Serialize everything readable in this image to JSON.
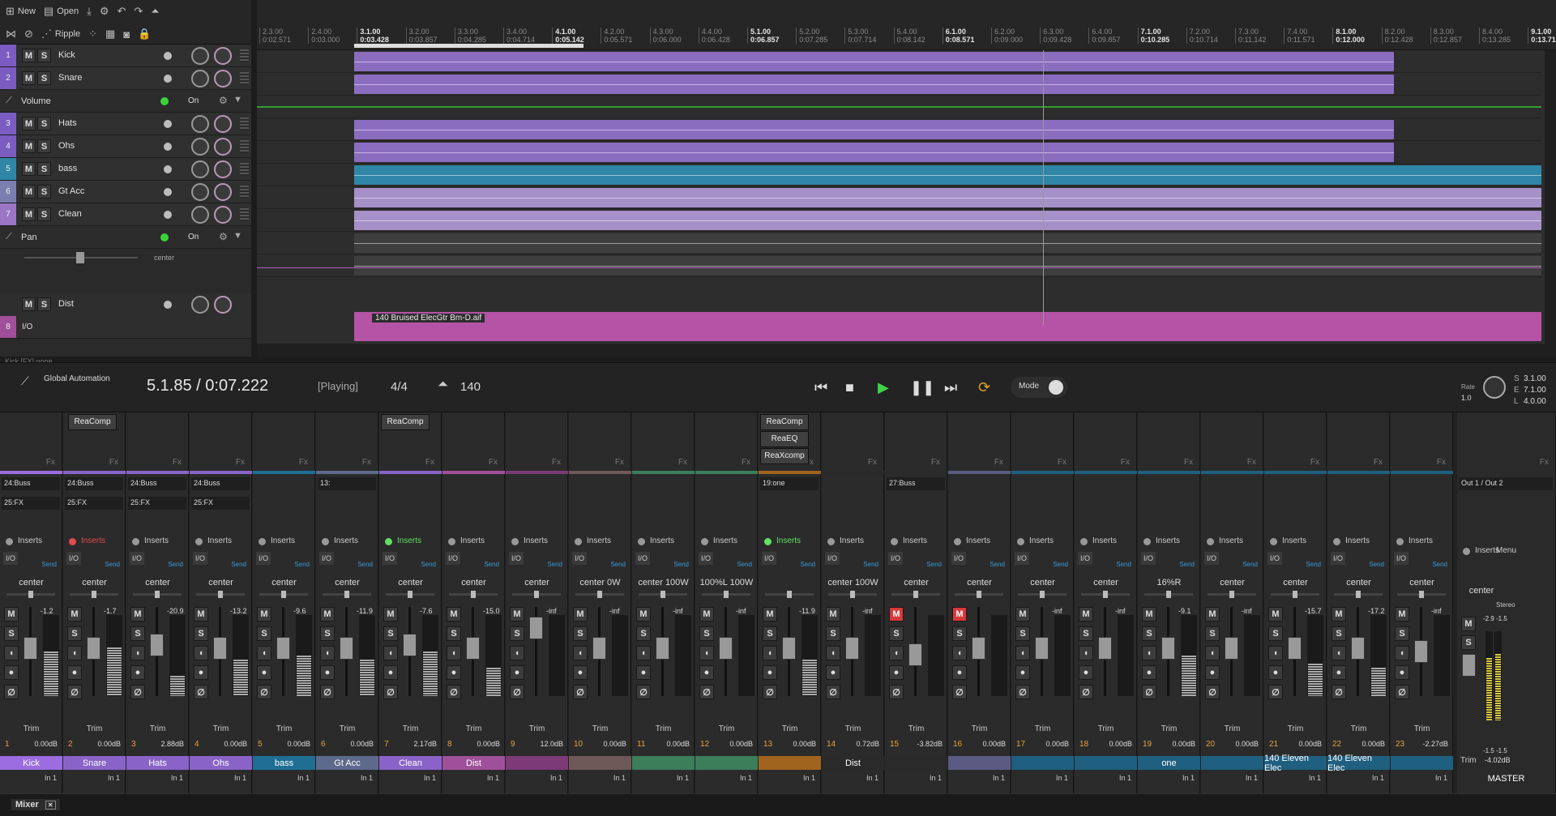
{
  "toolbar": {
    "row1": [
      {
        "icon": "new-icon",
        "glyph": "⊞",
        "label": "New"
      },
      {
        "icon": "open-icon",
        "glyph": "▤",
        "label": "Open"
      },
      {
        "icon": "save-icon",
        "glyph": "⤓",
        "label": ""
      },
      {
        "icon": "settings-icon",
        "glyph": "⚙",
        "label": ""
      },
      {
        "icon": "undo-icon",
        "glyph": "↶",
        "label": ""
      },
      {
        "icon": "redo-icon",
        "glyph": "↷",
        "label": ""
      },
      {
        "icon": "metronome-icon",
        "glyph": "⏶",
        "label": ""
      }
    ],
    "row2": [
      {
        "icon": "trim-icon",
        "glyph": "⋈",
        "label": ""
      },
      {
        "icon": "link-icon",
        "glyph": "⊘",
        "label": ""
      },
      {
        "icon": "ripple-icon",
        "glyph": "⋰",
        "label": "Ripple"
      },
      {
        "icon": "grid-icon",
        "glyph": "⁘",
        "label": ""
      },
      {
        "icon": "snap-icon",
        "glyph": "▦",
        "label": ""
      },
      {
        "icon": "envelope-icon",
        "glyph": "◙",
        "label": ""
      },
      {
        "icon": "lock-icon",
        "glyph": "🔒",
        "label": ""
      }
    ]
  },
  "tracks": [
    {
      "num": "1",
      "name": "Kick",
      "color": "#7b5cc0",
      "type": "track"
    },
    {
      "num": "2",
      "name": "Snare",
      "color": "#7b5cc0",
      "type": "track"
    },
    {
      "num": "",
      "name": "Volume",
      "color": "#2c2c2c",
      "type": "envelope",
      "on": "On"
    },
    {
      "num": "3",
      "name": "Hats",
      "color": "#7b5cc0",
      "type": "track"
    },
    {
      "num": "4",
      "name": "Ohs",
      "color": "#7b5cc0",
      "type": "track"
    },
    {
      "num": "5",
      "name": "bass",
      "color": "#2f86a6",
      "type": "track"
    },
    {
      "num": "6",
      "name": "Gt Acc",
      "color": "#7b7fb0",
      "type": "track"
    },
    {
      "num": "7",
      "name": "Clean",
      "color": "#9b76c4",
      "type": "track"
    },
    {
      "num": "",
      "name": "Pan",
      "color": "#2c2c2c",
      "type": "envelope",
      "on": "On"
    }
  ],
  "pan_envelope_value": "center",
  "folder_track": {
    "num": "8",
    "name": "Dist",
    "io": "I/O"
  },
  "track_status": "Kick [FX] none",
  "timeline": {
    "bars": [
      {
        "bar": "2.3.00",
        "time": "0:02.571",
        "major": false
      },
      {
        "bar": "2.4.00",
        "time": "0:03.000",
        "major": false
      },
      {
        "bar": "3.1.00",
        "time": "0:03.428",
        "major": true
      },
      {
        "bar": "3.2.00",
        "time": "0:03.857",
        "major": false
      },
      {
        "bar": "3.3.00",
        "time": "0:04.285",
        "major": false
      },
      {
        "bar": "3.4.00",
        "time": "0:04.714",
        "major": false
      },
      {
        "bar": "4.1.00",
        "time": "0:05.142",
        "major": true
      },
      {
        "bar": "4.2.00",
        "time": "0:05.571",
        "major": false
      },
      {
        "bar": "4.3.00",
        "time": "0:06.000",
        "major": false
      },
      {
        "bar": "4.4.00",
        "time": "0:06.428",
        "major": false
      },
      {
        "bar": "5.1.00",
        "time": "0:06.857",
        "major": true
      },
      {
        "bar": "5.2.00",
        "time": "0:07.285",
        "major": false
      },
      {
        "bar": "5.3.00",
        "time": "0:07.714",
        "major": false
      },
      {
        "bar": "5.4.00",
        "time": "0:08.142",
        "major": false
      },
      {
        "bar": "6.1.00",
        "time": "0:08.571",
        "major": true
      },
      {
        "bar": "6.2.00",
        "time": "0:09.000",
        "major": false
      },
      {
        "bar": "6.3.00",
        "time": "0:09.428",
        "major": false
      },
      {
        "bar": "6.4.00",
        "time": "0:09.857",
        "major": false
      },
      {
        "bar": "7.1.00",
        "time": "0:10.285",
        "major": true
      },
      {
        "bar": "7.2.00",
        "time": "0:10.714",
        "major": false
      },
      {
        "bar": "7.3.00",
        "time": "0:11.142",
        "major": false
      },
      {
        "bar": "7.4.00",
        "time": "0:11.571",
        "major": false
      },
      {
        "bar": "8.1.00",
        "time": "0:12.000",
        "major": true
      },
      {
        "bar": "8.2.00",
        "time": "0:12.428",
        "major": false
      },
      {
        "bar": "8.3.00",
        "time": "0:12.857",
        "major": false
      },
      {
        "bar": "8.4.00",
        "time": "0:13.285",
        "major": false
      },
      {
        "bar": "9.1.00",
        "time": "0:13.714",
        "major": true
      }
    ]
  },
  "item_label": "140 Bruised ElecGtr Bm-D.aif",
  "transport": {
    "global_automation": "Global Automation",
    "position": "5.1.85 / 0:07.222",
    "state": "[Playing]",
    "time_sig": "4/4",
    "bpm": "140",
    "mode": "Mode",
    "rate_label": "Rate",
    "rate": "1.0",
    "sel_start": "3.1.00",
    "sel_end": "7.1.00",
    "sel_len": "4.0.00",
    "sel_start_key": "S",
    "sel_end_key": "E",
    "sel_len_key": "L"
  },
  "fx_popups": {
    "strip2": "ReaComp",
    "strip7": "ReaComp",
    "strip13": [
      "ReaComp",
      "ReaEQ",
      "ReaXcomp"
    ]
  },
  "mixer": {
    "fx_label": "Fx",
    "inserts_label": "Inserts",
    "io_label": "I/O",
    "trim_label": "Trim",
    "send_label": "Send",
    "strips": [
      {
        "num": "1",
        "name": "Kick",
        "color": "#9b6de0",
        "pan": "center",
        "peak": "-1.2",
        "vol": "0.00dB",
        "in": "In 1",
        "sends": [
          "24:Buss",
          "25:FX"
        ],
        "ins": "normal",
        "fader": 0.55,
        "level": 0.55,
        "mute": false
      },
      {
        "num": "2",
        "name": "Snare",
        "color": "#8a63c8",
        "pan": "center",
        "peak": "-1.7",
        "vol": "0.00dB",
        "in": "In 1",
        "sends": [
          "24:Buss",
          "25:FX"
        ],
        "ins": "red",
        "fader": 0.55,
        "level": 0.6,
        "mute": false
      },
      {
        "num": "3",
        "name": "Hats",
        "color": "#8a63c8",
        "pan": "center",
        "peak": "-20.9",
        "vol": "2.88dB",
        "in": "In 1",
        "sends": [
          "24:Buss",
          "25:FX"
        ],
        "ins": "normal",
        "fader": 0.6,
        "level": 0.25,
        "mute": false
      },
      {
        "num": "4",
        "name": "Ohs",
        "color": "#8a63c8",
        "pan": "center",
        "peak": "-13.2",
        "vol": "0.00dB",
        "in": "In 1",
        "sends": [
          "24:Buss",
          "25:FX"
        ],
        "ins": "normal",
        "fader": 0.55,
        "level": 0.45,
        "mute": false
      },
      {
        "num": "5",
        "name": "bass",
        "color": "#1f6f95",
        "pan": "center",
        "peak": "-9.6",
        "vol": "0.00dB",
        "in": "In 1",
        "sends": [],
        "ins": "normal",
        "fader": 0.55,
        "level": 0.5,
        "mute": false
      },
      {
        "num": "6",
        "name": "Gt Acc",
        "color": "#5e6a8c",
        "pan": "center",
        "peak": "-11.9",
        "vol": "0.00dB",
        "in": "In 1",
        "sends": [
          "13:"
        ],
        "ins": "normal",
        "fader": 0.55,
        "level": 0.45,
        "mute": false
      },
      {
        "num": "7",
        "name": "Clean",
        "color": "#8a63c8",
        "pan": "center",
        "peak": "-7.6",
        "vol": "2.17dB",
        "in": "In 1",
        "sends": [],
        "ins": "green",
        "fader": 0.6,
        "level": 0.55,
        "mute": false
      },
      {
        "num": "8",
        "name": "Dist",
        "color": "#a0509a",
        "pan": "center",
        "peak": "-15.0",
        "vol": "0.00dB",
        "in": "In 1",
        "sends": [],
        "ins": "normal",
        "fader": 0.55,
        "level": 0.35,
        "mute": false
      },
      {
        "num": "9",
        "name": "",
        "color": "#7d3a78",
        "pan": "center",
        "peak": "-inf",
        "vol": "12.0dB",
        "in": "In 1",
        "sends": [],
        "ins": "normal",
        "fader": 0.85,
        "level": 0.0,
        "mute": false
      },
      {
        "num": "10",
        "name": "",
        "color": "#6e5858",
        "pan": "center  0W",
        "peak": "-inf",
        "vol": "0.00dB",
        "in": "In 1",
        "sends": [],
        "ins": "normal",
        "fader": 0.55,
        "level": 0.0,
        "mute": false
      },
      {
        "num": "11",
        "name": "",
        "color": "#3c7e5a",
        "pan": "center  100W",
        "peak": "-inf",
        "vol": "0.00dB",
        "in": "In 1",
        "sends": [],
        "ins": "normal",
        "fader": 0.55,
        "level": 0.0,
        "mute": false
      },
      {
        "num": "12",
        "name": "",
        "color": "#3c7e5a",
        "pan": "100%L  100W",
        "peak": "-inf",
        "vol": "0.00dB",
        "in": "In 1",
        "sends": [],
        "ins": "normal",
        "fader": 0.55,
        "level": 0.0,
        "mute": false
      },
      {
        "num": "13",
        "name": "",
        "color": "#a0641e",
        "pan": "",
        "peak": "-11.9",
        "vol": "0.00dB",
        "in": "In 1",
        "sends": [
          "19:one"
        ],
        "ins": "green",
        "fader": 0.55,
        "level": 0.45,
        "mute": false
      },
      {
        "num": "14",
        "name": "Dist",
        "color": "#2a2a2a",
        "pan": "center  100W",
        "peak": "-inf",
        "vol": "0.72dB",
        "in": "In 1",
        "sends": [],
        "ins": "normal",
        "fader": 0.55,
        "level": 0.0,
        "mute": false
      },
      {
        "num": "15",
        "name": "",
        "color": "#2a2a2a",
        "pan": "center",
        "peak": "",
        "vol": "-3.82dB",
        "in": "In 1",
        "sends": [
          "27:Buss"
        ],
        "ins": "normal",
        "fader": 0.45,
        "level": 0.0,
        "mute": true
      },
      {
        "num": "16",
        "name": "",
        "color": "#5a5a82",
        "pan": "center",
        "peak": "",
        "vol": "0.00dB",
        "in": "In 1",
        "sends": [],
        "ins": "normal",
        "fader": 0.55,
        "level": 0.0,
        "mute": true
      },
      {
        "num": "17",
        "name": "",
        "color": "#1f5f80",
        "pan": "center",
        "peak": "-inf",
        "vol": "0.00dB",
        "in": "In 1",
        "sends": [],
        "ins": "normal",
        "fader": 0.55,
        "level": 0.0,
        "mute": false
      },
      {
        "num": "18",
        "name": "",
        "color": "#1f5f80",
        "pan": "center",
        "peak": "-inf",
        "vol": "0.00dB",
        "in": "In 1",
        "sends": [],
        "ins": "normal",
        "fader": 0.55,
        "level": 0.0,
        "mute": false
      },
      {
        "num": "19",
        "name": "one",
        "color": "#1f5f80",
        "pan": "16%R",
        "peak": "-9.1",
        "vol": "0.00dB",
        "in": "In 1",
        "sends": [],
        "ins": "normal",
        "fader": 0.55,
        "level": 0.5,
        "mute": false
      },
      {
        "num": "20",
        "name": "",
        "color": "#1f5f80",
        "pan": "center",
        "peak": "-inf",
        "vol": "0.00dB",
        "in": "In 1",
        "sends": [],
        "ins": "normal",
        "fader": 0.55,
        "level": 0.0,
        "mute": false
      },
      {
        "num": "21",
        "name": "140 Eleven Elec",
        "color": "#1f5f80",
        "pan": "center",
        "peak": "-15.7",
        "vol": "0.00dB",
        "in": "In 1",
        "sends": [],
        "ins": "normal",
        "fader": 0.55,
        "level": 0.4,
        "mute": false
      },
      {
        "num": "22",
        "name": "140 Eleven Elec",
        "color": "#1f5f80",
        "pan": "center",
        "peak": "-17.2",
        "vol": "0.00dB",
        "in": "In 1",
        "sends": [],
        "ins": "normal",
        "fader": 0.55,
        "level": 0.35,
        "mute": false
      },
      {
        "num": "23",
        "name": "",
        "color": "#1f5f80",
        "pan": "center",
        "peak": "-inf",
        "vol": "-2.27dB",
        "in": "In 1",
        "sends": [],
        "ins": "normal",
        "fader": 0.5,
        "level": 0.0,
        "mute": false
      }
    ],
    "master": {
      "name": "MASTER",
      "out": "Out 1 / Out 2",
      "menu": "Menu",
      "pan": "center",
      "stereo": "Stereo",
      "peak_l": "-2.9",
      "peak_r": "-1.5",
      "meter_l": "-1.5",
      "meter_r": "-1.5",
      "trim": "Trim",
      "vol": "-4.02dB",
      "level_l": 0.7,
      "level_r": 0.75
    }
  },
  "statusbar": {
    "mixer_tab": "Mixer"
  }
}
